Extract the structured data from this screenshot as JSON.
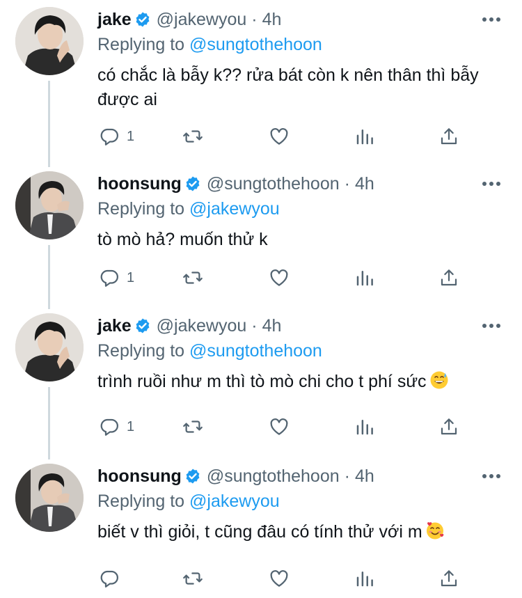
{
  "colors": {
    "accent": "#1d9bf0",
    "secondary_text": "#536471",
    "thread_line": "#cfd9de"
  },
  "tweets": [
    {
      "name": "jake",
      "handle": "@jakewyou",
      "separator": "·",
      "time": "4h",
      "replying_label": "Replying to",
      "replying_handle": "@sungtothehoon",
      "text": "có chắc là bẫy k?? rửa bát còn k nên thân thì bẫy được ai",
      "reply_count": "1",
      "emoji": ""
    },
    {
      "name": "hoonsung",
      "handle": "@sungtothehoon",
      "separator": "·",
      "time": "4h",
      "replying_label": "Replying to",
      "replying_handle": "@jakewyou",
      "text": "tò mò hả? muốn thử k",
      "reply_count": "1",
      "emoji": ""
    },
    {
      "name": "jake",
      "handle": "@jakewyou",
      "separator": "·",
      "time": "4h",
      "replying_label": "Replying to",
      "replying_handle": "@sungtothehoon",
      "text": "trình ruồi như m thì tò mò chi cho t phí sức",
      "reply_count": "1",
      "emoji": "grinning-sweat-emoji"
    },
    {
      "name": "hoonsung",
      "handle": "@sungtothehoon",
      "separator": "·",
      "time": "4h",
      "replying_label": "Replying to",
      "replying_handle": "@jakewyou",
      "text": "biết v thì giỏi, t cũng đâu có tính thử với m",
      "reply_count": "",
      "emoji": "smiling-hearts-emoji"
    }
  ],
  "icons": [
    "verified-icon",
    "more-icon",
    "reply-icon",
    "retweet-icon",
    "like-icon",
    "views-icon",
    "share-icon"
  ]
}
